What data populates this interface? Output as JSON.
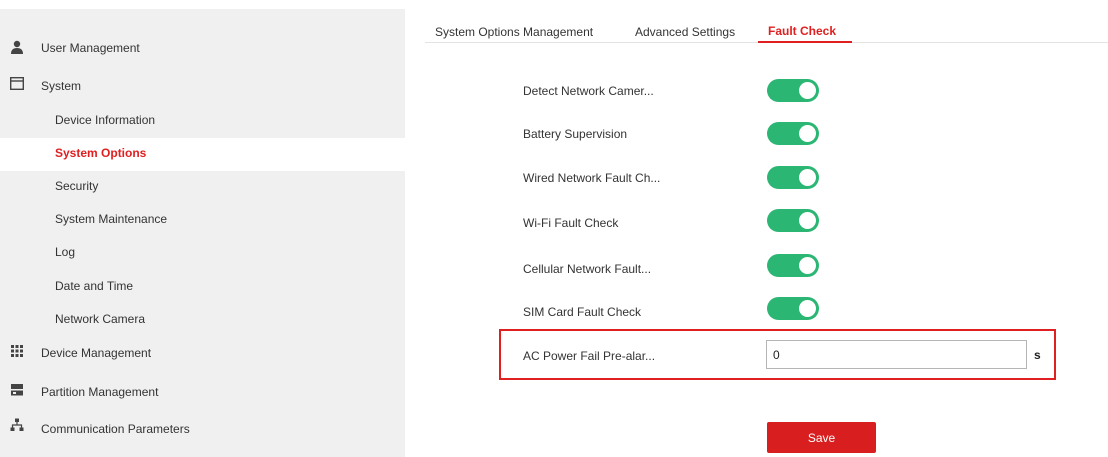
{
  "sidebar": {
    "items": [
      {
        "label": "User Management",
        "icon": "user-icon"
      },
      {
        "label": "System",
        "icon": "window-icon"
      },
      {
        "label": "Device Information"
      },
      {
        "label": "System Options"
      },
      {
        "label": "Security"
      },
      {
        "label": "System Maintenance"
      },
      {
        "label": "Log"
      },
      {
        "label": "Date and Time"
      },
      {
        "label": "Network Camera"
      },
      {
        "label": "Device Management",
        "icon": "grid-icon"
      },
      {
        "label": "Partition Management",
        "icon": "partition-icon"
      },
      {
        "label": "Communication Parameters",
        "icon": "network-icon"
      }
    ],
    "active": "System Options"
  },
  "tabs": [
    {
      "label": "System Options Management"
    },
    {
      "label": "Advanced Settings"
    },
    {
      "label": "Fault Check"
    }
  ],
  "settings": [
    {
      "label": "Detect Network Camer...",
      "enabled": true
    },
    {
      "label": "Battery Supervision",
      "enabled": true
    },
    {
      "label": "Wired Network Fault Ch...",
      "enabled": true
    },
    {
      "label": "Wi-Fi Fault Check",
      "enabled": true
    },
    {
      "label": "Cellular Network Fault...",
      "enabled": true
    },
    {
      "label": "SIM Card Fault Check",
      "enabled": true
    }
  ],
  "ac_power": {
    "label": "AC Power Fail Pre-alar...",
    "value": "0",
    "unit": "s"
  },
  "save_label": "Save",
  "colors": {
    "accent": "#e02020",
    "toggle_on": "#2bb673",
    "sidebar_bg": "#f0f0f0"
  }
}
